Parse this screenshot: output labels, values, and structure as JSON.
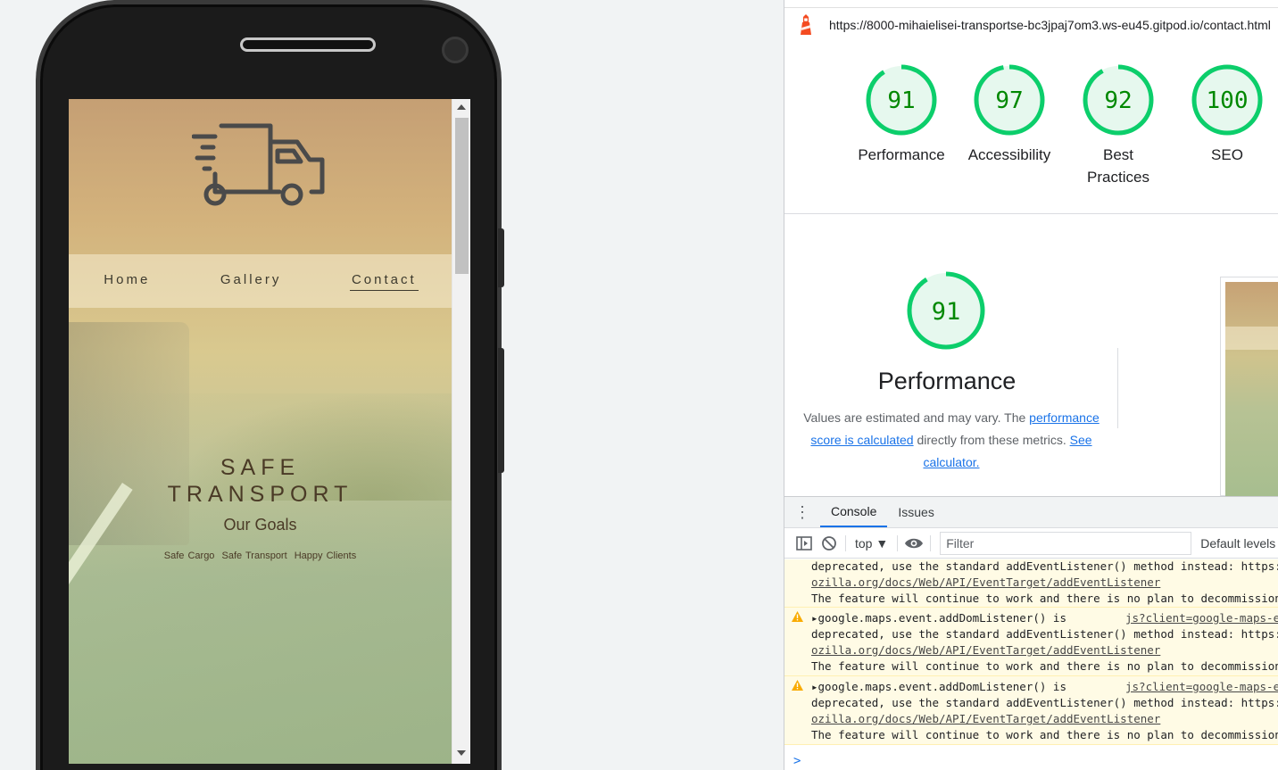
{
  "site": {
    "nav": [
      {
        "label": "Home",
        "active": false
      },
      {
        "label": "Gallery",
        "active": false
      },
      {
        "label": "Contact",
        "active": true
      }
    ],
    "hero_title_line1": "SAFE",
    "hero_title_line2": "TRANSPORT",
    "hero_subtitle": "Our Goals",
    "hero_tags": [
      "Safe Cargo",
      "Safe Transport",
      "Happy Clients"
    ],
    "logo_icon": "truck-icon"
  },
  "lighthouse": {
    "url": "https://8000-mihaielisei-transportse-bc3jpaj7om3.ws-eu45.gitpod.io/contact.html",
    "gauge_color": "#0cce6b",
    "gauge_text_color": "#008800",
    "scores": [
      {
        "label_line1": "Performance",
        "label_line2": "",
        "value": "91",
        "fraction": 0.91
      },
      {
        "label_line1": "Accessibility",
        "label_line2": "",
        "value": "97",
        "fraction": 0.97
      },
      {
        "label_line1": "Best",
        "label_line2": "Practices",
        "value": "92",
        "fraction": 0.92
      },
      {
        "label_line1": "SEO",
        "label_line2": "",
        "value": "100",
        "fraction": 1.0
      }
    ],
    "performance": {
      "value": "91",
      "fraction": 0.91,
      "title": "Performance",
      "desc_prefix": "Values are estimated and may vary. The ",
      "desc_link1": "performance score is calculated",
      "desc_middle": " directly from these metrics. ",
      "desc_link2": "See calculator."
    }
  },
  "drawer": {
    "tabs": [
      {
        "label": "Console",
        "active": true
      },
      {
        "label": "Issues",
        "active": false
      }
    ],
    "context": "top",
    "filter_placeholder": "Filter",
    "levels_label": "Default levels",
    "warn_color": "#f9ab00"
  },
  "console": {
    "partial_message": {
      "line1": "deprecated, use the standard addEventListener() method instead: https://developer.m",
      "line2": "ozilla.org/docs/Web/API/EventTarget/addEventListener",
      "line3": "The feature will continue to work and there is no plan to decommission it."
    },
    "messages": [
      {
        "head": "google.maps.event.addDomListener() is",
        "source": "js?client=google-maps-embed",
        "line1": "deprecated, use the standard addEventListener() method instead: https://developer.m",
        "line2": "ozilla.org/docs/Web/API/EventTarget/addEventListener",
        "line3": "The feature will continue to work and there is no plan to decommission it."
      },
      {
        "head": "google.maps.event.addDomListener() is",
        "source": "js?client=google-maps-embed",
        "line1": "deprecated, use the standard addEventListener() method instead: https://developer.m",
        "line2": "ozilla.org/docs/Web/API/EventTarget/addEventListener",
        "line3": "The feature will continue to work and there is no plan to decommission it."
      }
    ],
    "prompt": ">"
  }
}
